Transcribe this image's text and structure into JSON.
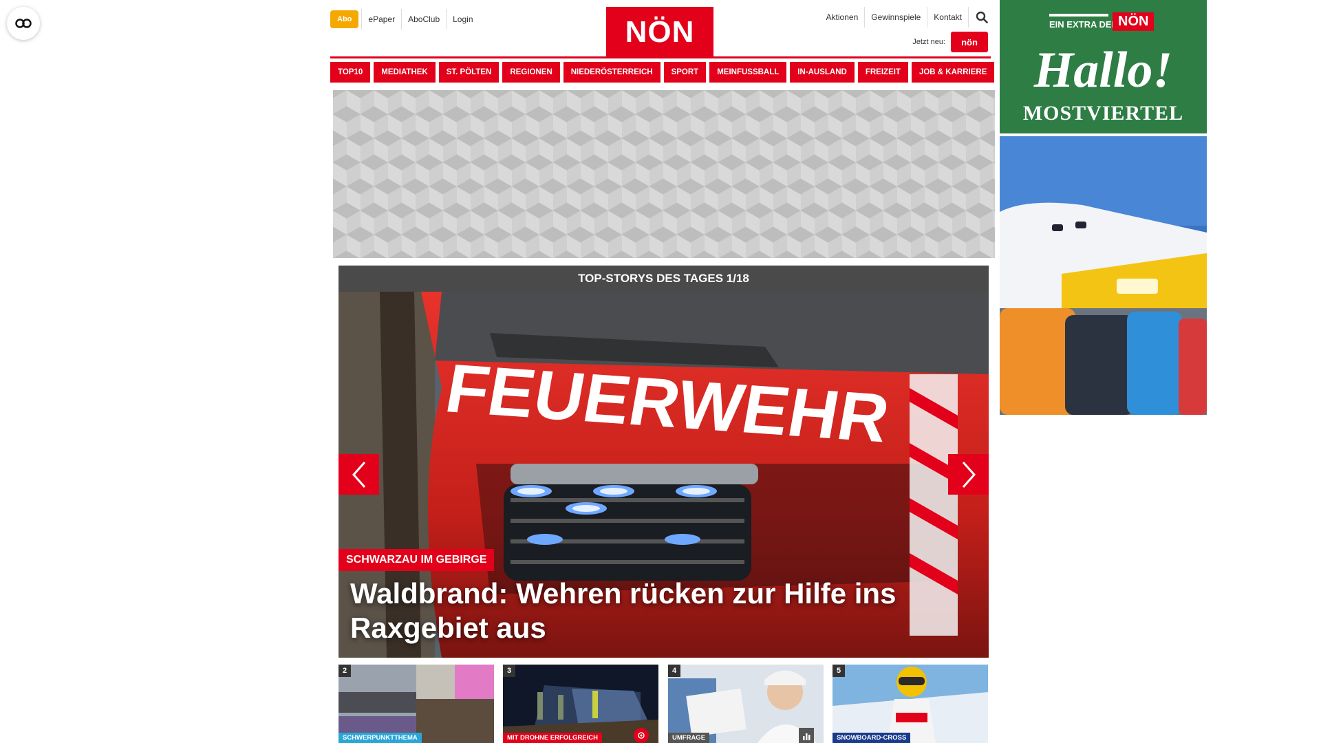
{
  "accessibility": {
    "icon": "accessibility-icon"
  },
  "header": {
    "top_links_left": {
      "abo": "Abo",
      "epaper": "ePaper",
      "aboclub": "AboClub",
      "login": "Login"
    },
    "logo": "NÖN",
    "top_links_right": {
      "aktionen": "Aktionen",
      "gewinnspiele": "Gewinnspiele",
      "kontakt": "Kontakt"
    },
    "jetzt_neu": "Jetzt neu:",
    "jetzt_badge": "nön",
    "brand_color": "#e2001a"
  },
  "nav": {
    "items": [
      {
        "label": "TOP10"
      },
      {
        "label": "MEDIATHEK"
      },
      {
        "label": "ST. PÖLTEN"
      },
      {
        "label": "REGIONEN"
      },
      {
        "label": "NIEDERÖSTERREICH"
      },
      {
        "label": "SPORT"
      },
      {
        "label": "MEINFUSSBALL"
      },
      {
        "label": "IN-AUSLAND"
      },
      {
        "label": "FREIZEIT"
      },
      {
        "label": "JOB & KARRIERE"
      }
    ]
  },
  "stories": {
    "heading": "TOP-STORYS DES TAGES 1/18",
    "hero": {
      "tag": "SCHWARZAU IM GEBIRGE",
      "title": "Waldbrand: Wehren rücken zur Hilfe ins Raxgebiet aus",
      "image_text": "FEUERWEHR"
    },
    "thumbs": [
      {
        "num": "2",
        "tag": "SCHWERPUNKTTHEMA",
        "tag_color": "#2aa6d6"
      },
      {
        "num": "3",
        "tag": "MIT DROHNE ERFOLGREICH",
        "tag_color": "#e2001a"
      },
      {
        "num": "4",
        "tag": "UMFRAGE",
        "tag_color": "#555555"
      },
      {
        "num": "5",
        "tag": "SNOWBOARD-CROSS",
        "tag_color": "#1a3b8c"
      }
    ]
  },
  "ads": {
    "ad1": {
      "extra": "EIN EXTRA DER",
      "logo": "NÖN",
      "hallo": "Hallo!",
      "region": "MOSTVIERTEL"
    }
  }
}
